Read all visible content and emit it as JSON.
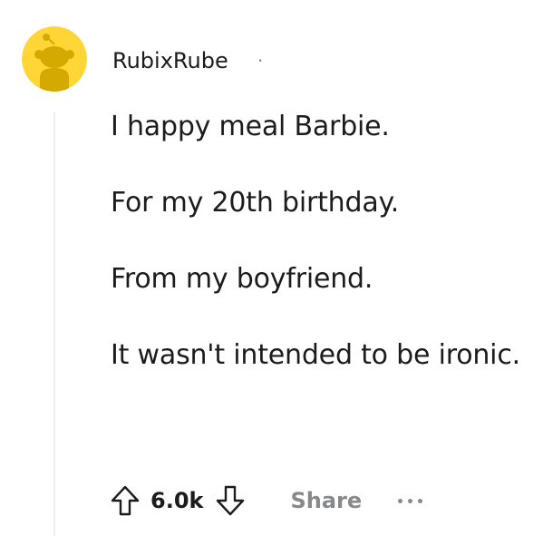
{
  "comment": {
    "author": "RubixRube",
    "separator": "·",
    "paragraphs": [
      "I happy meal Barbie.",
      "For my 20th birthday.",
      "From my boyfriend.",
      "It wasn't intended to be ironic."
    ],
    "avatar_icon": "snoo-avatar-icon",
    "avatar_color": "#ffd635"
  },
  "actions": {
    "upvote_icon": "upvote-arrow-icon",
    "score": "6.0k",
    "downvote_icon": "downvote-arrow-icon",
    "share_label": "Share",
    "more_icon": "more-options-icon"
  }
}
